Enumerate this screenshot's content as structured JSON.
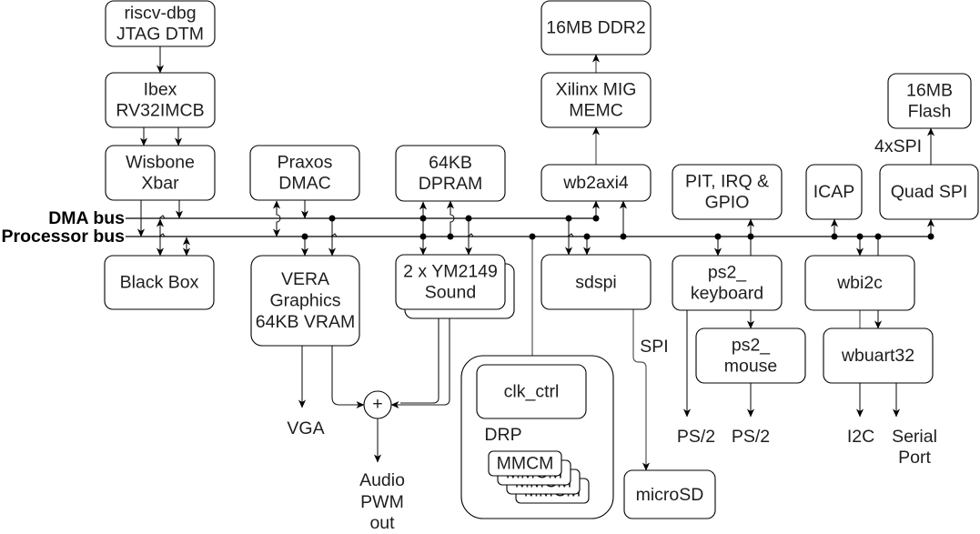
{
  "diagram": {
    "bus_labels": {
      "dma": "DMA bus",
      "processor": "Processor bus"
    },
    "blocks": {
      "riscv_dbg": [
        "riscv-dbg",
        "JTAG DTM"
      ],
      "ibex": [
        "Ibex",
        "RV32IMCB"
      ],
      "xbar": [
        "Wisbone",
        "Xbar"
      ],
      "praxos": [
        "Praxos",
        "DMAC"
      ],
      "dpram": [
        "64KB",
        "DPRAM"
      ],
      "ddr2": [
        "16MB DDR2"
      ],
      "mig": [
        "Xilinx MIG",
        "MEMC"
      ],
      "wb2axi4": [
        "wb2axi4"
      ],
      "pit": [
        "PIT, IRQ &",
        "GPIO"
      ],
      "icap": [
        "ICAP"
      ],
      "quadspi": [
        "Quad SPI"
      ],
      "flash": [
        "16MB",
        "Flash"
      ],
      "blackbox": [
        "Black Box"
      ],
      "vera": [
        "VERA",
        "Graphics",
        "64KB VRAM"
      ],
      "ym2149": [
        "2 x YM2149",
        "Sound"
      ],
      "sdspi": [
        "sdspi"
      ],
      "ps2_keyboard": [
        "ps2_",
        "keyboard"
      ],
      "ps2_mouse": [
        "ps2_",
        "mouse"
      ],
      "wbi2c": [
        "wbi2c"
      ],
      "wbuart32": [
        "wbuart32"
      ],
      "clk_ctrl": [
        "clk_ctrl"
      ],
      "mmcm": [
        "MMCM"
      ],
      "microsd": [
        "microSD"
      ]
    },
    "edge_labels": {
      "quad_spi": "4xSPI",
      "spi": "SPI",
      "drp": "DRP",
      "vga": "VGA",
      "audio": [
        "Audio",
        "PWM",
        "out"
      ],
      "ps2_keyboard_out": "PS/2",
      "ps2_mouse_out": "PS/2",
      "i2c": "I2C",
      "serial": [
        "Serial",
        "Port"
      ],
      "mixer_symbol": "+"
    }
  }
}
